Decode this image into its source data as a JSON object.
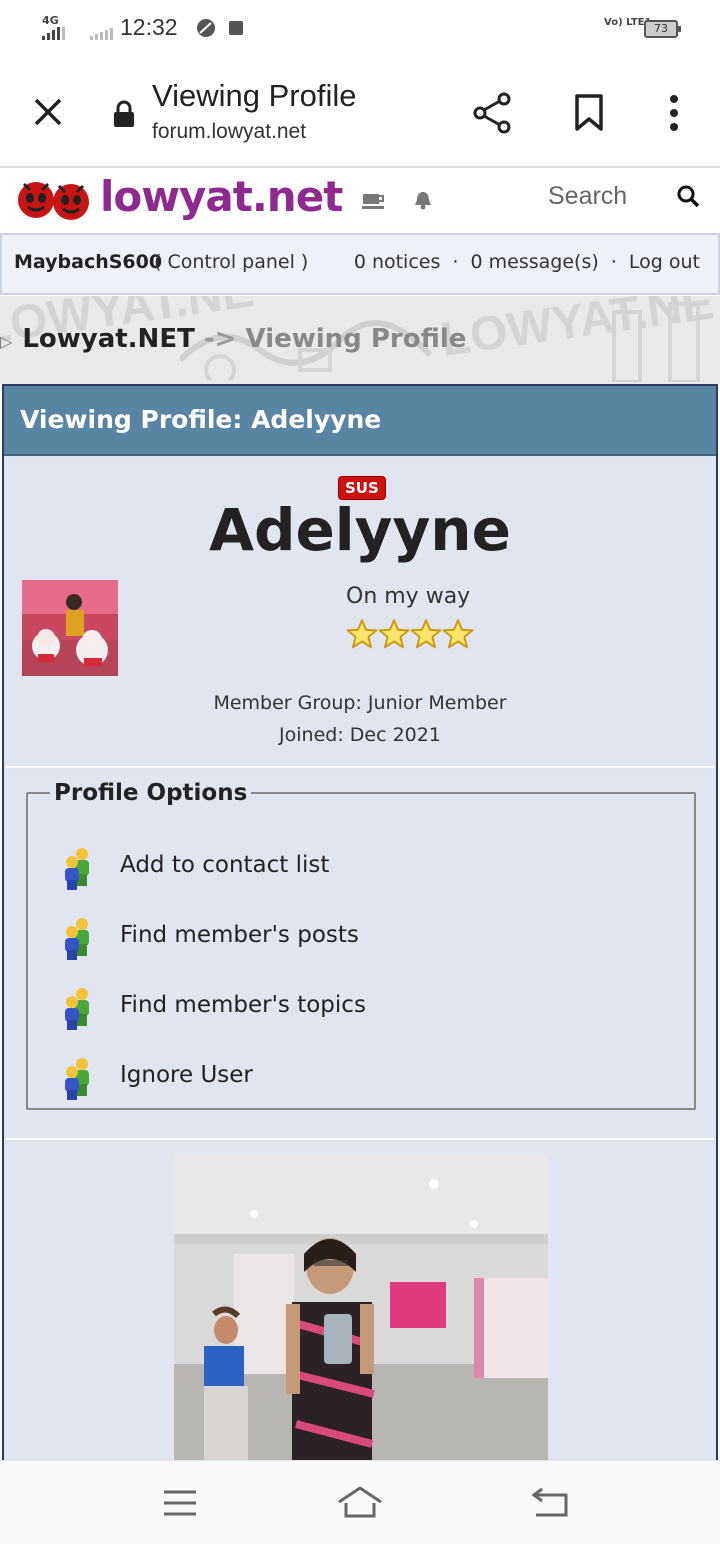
{
  "status": {
    "network": "4G",
    "time": "12:32",
    "volte": "Vo) LTE1",
    "battery": "73"
  },
  "browser": {
    "title": "Viewing Profile",
    "url": "forum.lowyat.net"
  },
  "site": {
    "logo": "lowyat.net",
    "search_label": "Search"
  },
  "user_bar": {
    "username": "MaybachS600",
    "control_panel": "( Control panel )",
    "notices": "0 notices",
    "messages": "0 message(s)",
    "logout": "Log out",
    "separator": "·"
  },
  "breadcrumb": {
    "home": "Lowyat.NET",
    "sep": "->",
    "current": "Viewing Profile",
    "bg_text": "LOWYAT.NE"
  },
  "profile": {
    "heading": "Viewing Profile: Adelyyne",
    "badge": "SUS",
    "name": "Adelyyne",
    "motto": "On my way",
    "stars": 4,
    "member_group": "Member Group: Junior Member",
    "joined": "Joined: Dec 2021"
  },
  "options": {
    "legend": "Profile Options",
    "items": [
      {
        "label": "Add to contact list"
      },
      {
        "label": "Find member's posts"
      },
      {
        "label": "Find member's topics"
      },
      {
        "label": "Ignore User"
      }
    ]
  },
  "colors": {
    "brand": "#8e2a8f",
    "panel_header": "#5885a2",
    "panel_bg": "#e0e5ef",
    "badge": "#cc1111"
  }
}
